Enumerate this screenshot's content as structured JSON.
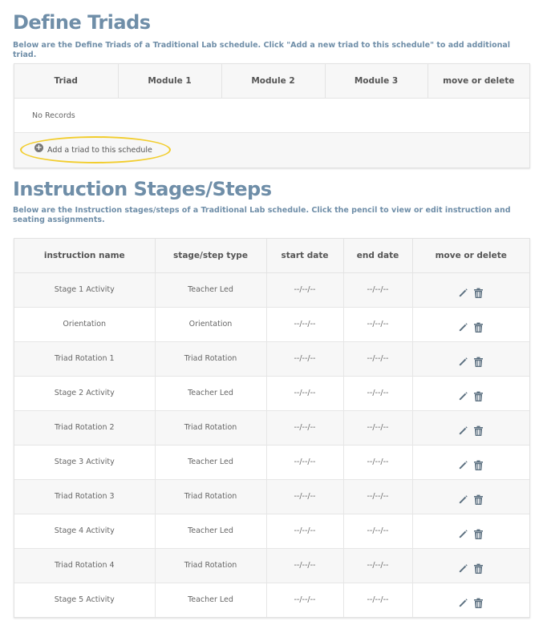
{
  "triads": {
    "title": "Define Triads",
    "description": "Below are the Define Triads of a Traditional Lab schedule. Click \"Add a new triad to this schedule\" to add additional triad.",
    "columns": [
      "Triad",
      "Module 1",
      "Module 2",
      "Module 3",
      "move or delete"
    ],
    "empty_text": "No Records",
    "add_label": "Add a triad to this schedule",
    "highlight_color": "#f2cd2d"
  },
  "steps": {
    "title": "Instruction Stages/Steps",
    "description": "Below are the Instruction stages/steps of a Traditional Lab schedule. Click the pencil to view or edit instruction and seating assignments.",
    "columns": [
      "instruction name",
      "stage/step type",
      "start date",
      "end date",
      "move or delete"
    ],
    "rows": [
      {
        "name": "Stage 1 Activity",
        "type": "Teacher Led",
        "start": "--/--/--",
        "end": "--/--/--"
      },
      {
        "name": "Orientation",
        "type": "Orientation",
        "start": "--/--/--",
        "end": "--/--/--"
      },
      {
        "name": "Triad Rotation 1",
        "type": "Triad Rotation",
        "start": "--/--/--",
        "end": "--/--/--"
      },
      {
        "name": "Stage 2 Activity",
        "type": "Teacher Led",
        "start": "--/--/--",
        "end": "--/--/--"
      },
      {
        "name": "Triad Rotation 2",
        "type": "Triad Rotation",
        "start": "--/--/--",
        "end": "--/--/--"
      },
      {
        "name": "Stage 3 Activity",
        "type": "Teacher Led",
        "start": "--/--/--",
        "end": "--/--/--"
      },
      {
        "name": "Triad Rotation 3",
        "type": "Triad Rotation",
        "start": "--/--/--",
        "end": "--/--/--"
      },
      {
        "name": "Stage 4 Activity",
        "type": "Teacher Led",
        "start": "--/--/--",
        "end": "--/--/--"
      },
      {
        "name": "Triad Rotation 4",
        "type": "Triad Rotation",
        "start": "--/--/--",
        "end": "--/--/--"
      },
      {
        "name": "Stage 5 Activity",
        "type": "Teacher Led",
        "start": "--/--/--",
        "end": "--/--/--"
      }
    ],
    "row_actions": [
      "pencil-icon",
      "trash-icon"
    ]
  },
  "colors": {
    "title": "#6f8ea8",
    "icon": "#5c7080"
  }
}
